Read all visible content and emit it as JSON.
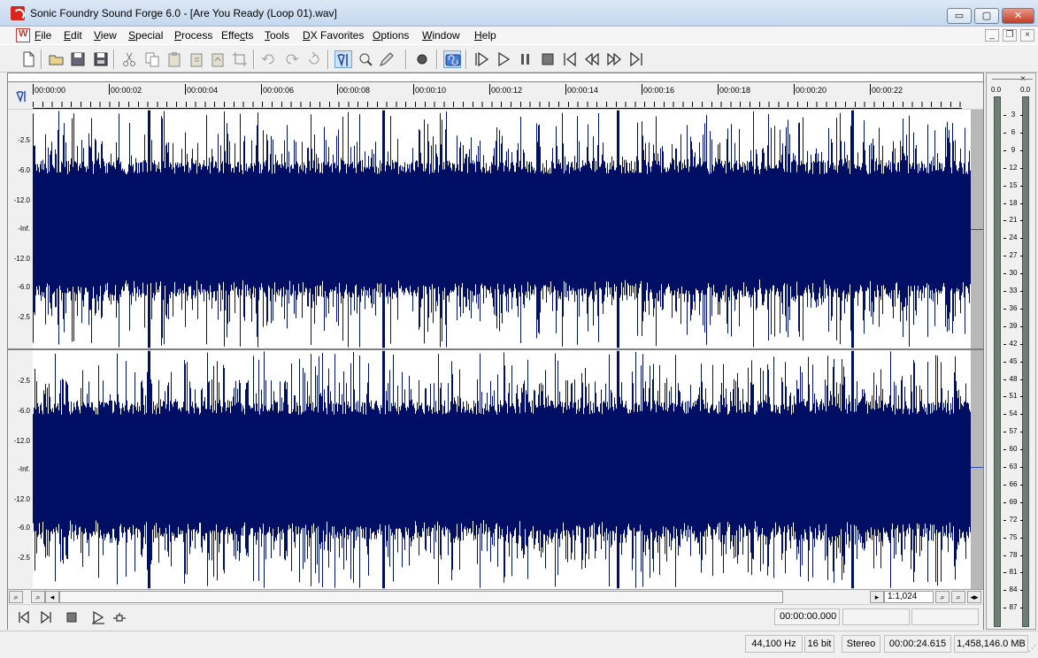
{
  "window": {
    "title": "Sonic Foundry Sound Forge 6.0 - [Are You Ready (Loop 01).wav]",
    "min_glyph": "▭",
    "max_glyph": "▢",
    "close_glyph": "✕"
  },
  "menu": [
    {
      "label": "File",
      "accel": "F"
    },
    {
      "label": "Edit",
      "accel": "E"
    },
    {
      "label": "View",
      "accel": "V"
    },
    {
      "label": "Special",
      "accel": "S"
    },
    {
      "label": "Process",
      "accel": "P"
    },
    {
      "label": "Effects",
      "accel": "c"
    },
    {
      "label": "Tools",
      "accel": "T"
    },
    {
      "label": "DX Favorites",
      "accel": "D"
    },
    {
      "label": "Options",
      "accel": "O"
    },
    {
      "label": "Window",
      "accel": "W"
    },
    {
      "label": "Help",
      "accel": "H"
    }
  ],
  "mdi_controls": {
    "min": "_",
    "restore": "❐",
    "close": "×"
  },
  "toolbar": {
    "buttons": [
      "new-file",
      "open-folder",
      "save",
      "save-all",
      "cut",
      "copy",
      "paste",
      "paste-new",
      "mix-paste",
      "crop",
      "undo",
      "redo",
      "repeat",
      "edit-tool",
      "magnify-tool",
      "pencil-tool",
      "record",
      "loop-playback",
      "play-all",
      "play",
      "pause",
      "stop",
      "go-to-start",
      "rewind",
      "forward",
      "go-to-end"
    ]
  },
  "timeline": {
    "ticks": [
      "00:00:00",
      "00:00:02",
      "00:00:04",
      "00:00:06",
      "00:00:08",
      "00:00:10",
      "00:00:12",
      "00:00:14",
      "00:00:16",
      "00:00:18",
      "00:00:20",
      "00:00:22"
    ]
  },
  "channels": [
    {
      "name": "left",
      "scale": [
        "-2.5",
        "-6.0",
        "-12.0",
        "-Inf.",
        "-12.0",
        "-6.0",
        "-2.5"
      ]
    },
    {
      "name": "right",
      "scale": [
        "-2.5",
        "-6.0",
        "-12.0",
        "-Inf.",
        "-12.0",
        "-6.0",
        "-2.5"
      ]
    }
  ],
  "zoom": {
    "ratio": "1:1,024"
  },
  "transport": {
    "selection_time": "00:00:00.000"
  },
  "meter": {
    "close": "×",
    "peak_left": "0.0",
    "peak_right": "0.0",
    "labels": [
      "3",
      "6",
      "9",
      "12",
      "15",
      "18",
      "21",
      "24",
      "27",
      "30",
      "33",
      "36",
      "39",
      "42",
      "45",
      "48",
      "51",
      "54",
      "57",
      "60",
      "63",
      "66",
      "69",
      "72",
      "75",
      "78",
      "81",
      "84",
      "87"
    ]
  },
  "status": {
    "sample_rate": "44,100 Hz",
    "bit_depth": "16 bit",
    "channels": "Stereo",
    "length": "00:00:24.615",
    "free_space": "1,458,146.0 MB"
  },
  "colors": {
    "waveform": "#000f64",
    "accent": "#2c4fae"
  }
}
